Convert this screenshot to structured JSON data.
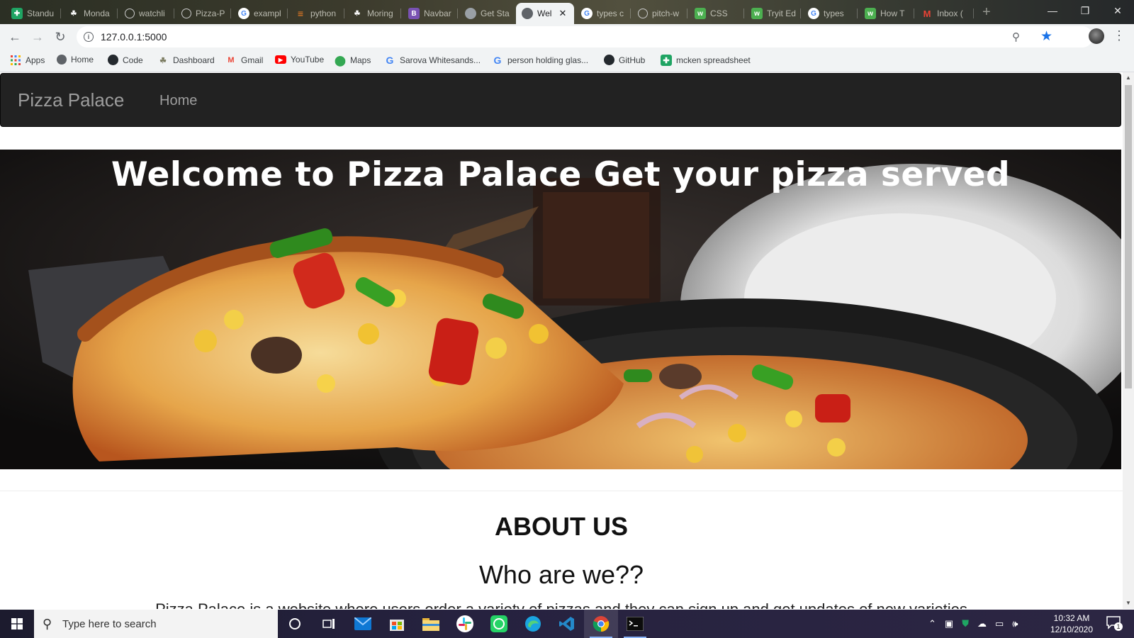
{
  "browser": {
    "tabs": [
      {
        "title": "Standu",
        "favicon": "sheets-icon",
        "color": "#1fa463"
      },
      {
        "title": "Monda",
        "favicon": "palm-icon",
        "color": "#6b6b5a"
      },
      {
        "title": "watchli",
        "favicon": "github-icon",
        "color": "#e8e8e8"
      },
      {
        "title": "Pizza-P",
        "favicon": "github-icon",
        "color": "#e8e8e8"
      },
      {
        "title": "exampl",
        "favicon": "google-icon",
        "color": "#4285f4"
      },
      {
        "title": "python",
        "favicon": "stackoverflow-icon",
        "color": "#f48024"
      },
      {
        "title": "Moring",
        "favicon": "palm-icon",
        "color": "#6b6b5a"
      },
      {
        "title": "Navbar",
        "favicon": "bootstrap-icon",
        "color": "#7952b3"
      },
      {
        "title": "Get Sta",
        "favicon": "globe-icon",
        "color": "#9aa0a6"
      },
      {
        "title": "Wel",
        "favicon": "globe-icon",
        "color": "#5f6368",
        "active": true
      },
      {
        "title": "types c",
        "favicon": "google-icon",
        "color": "#4285f4"
      },
      {
        "title": "pitch-w",
        "favicon": "github-icon",
        "color": "#e8e8e8"
      },
      {
        "title": "CSS",
        "favicon": "w3schools-icon",
        "color": "#4caf50"
      },
      {
        "title": "Tryit Ed",
        "favicon": "w3schools-icon",
        "color": "#4caf50"
      },
      {
        "title": "types",
        "favicon": "google-icon",
        "color": "#4285f4"
      },
      {
        "title": "How T",
        "favicon": "w3schools-icon",
        "color": "#4caf50"
      },
      {
        "title": "Inbox (",
        "favicon": "gmail-icon",
        "color": "#ea4335"
      }
    ],
    "new_tab": "+",
    "url": "127.0.0.1:5000",
    "bookmarks": [
      {
        "label": "Apps",
        "icon": "apps-grid-icon"
      },
      {
        "label": "Home",
        "icon": "globe-icon"
      },
      {
        "label": "Code",
        "icon": "github-icon"
      },
      {
        "label": "Dashboard",
        "icon": "palm-icon"
      },
      {
        "label": "Gmail",
        "icon": "gmail-icon"
      },
      {
        "label": "YouTube",
        "icon": "youtube-icon"
      },
      {
        "label": "Maps",
        "icon": "maps-pin-icon"
      },
      {
        "label": "Sarova Whitesands...",
        "icon": "google-icon"
      },
      {
        "label": "person holding glas...",
        "icon": "google-icon"
      },
      {
        "label": "GitHub",
        "icon": "github-icon"
      },
      {
        "label": "mcken spreadsheet",
        "icon": "sheets-icon"
      }
    ]
  },
  "site": {
    "brand": "Pizza Palace",
    "nav_home": "Home",
    "hero_title": "Welcome to Pizza Palace Get your pizza served",
    "about_title": "ABOUT US",
    "about_subtitle": "Who are we??",
    "about_text": "Pizza Palace is a website where users order a variety of pizzas and they can sign up and get updates of new varieties"
  },
  "taskbar": {
    "search_placeholder": "Type here to search",
    "time": "10:32 AM",
    "date": "12/10/2020",
    "notification_count": "1",
    "apps": [
      "cortana-icon",
      "task-view-icon",
      "mail-icon",
      "store-icon",
      "file-explorer-icon",
      "slack-icon",
      "whatsapp-icon",
      "edge-icon",
      "vscode-icon",
      "chrome-icon",
      "terminal-icon"
    ]
  }
}
